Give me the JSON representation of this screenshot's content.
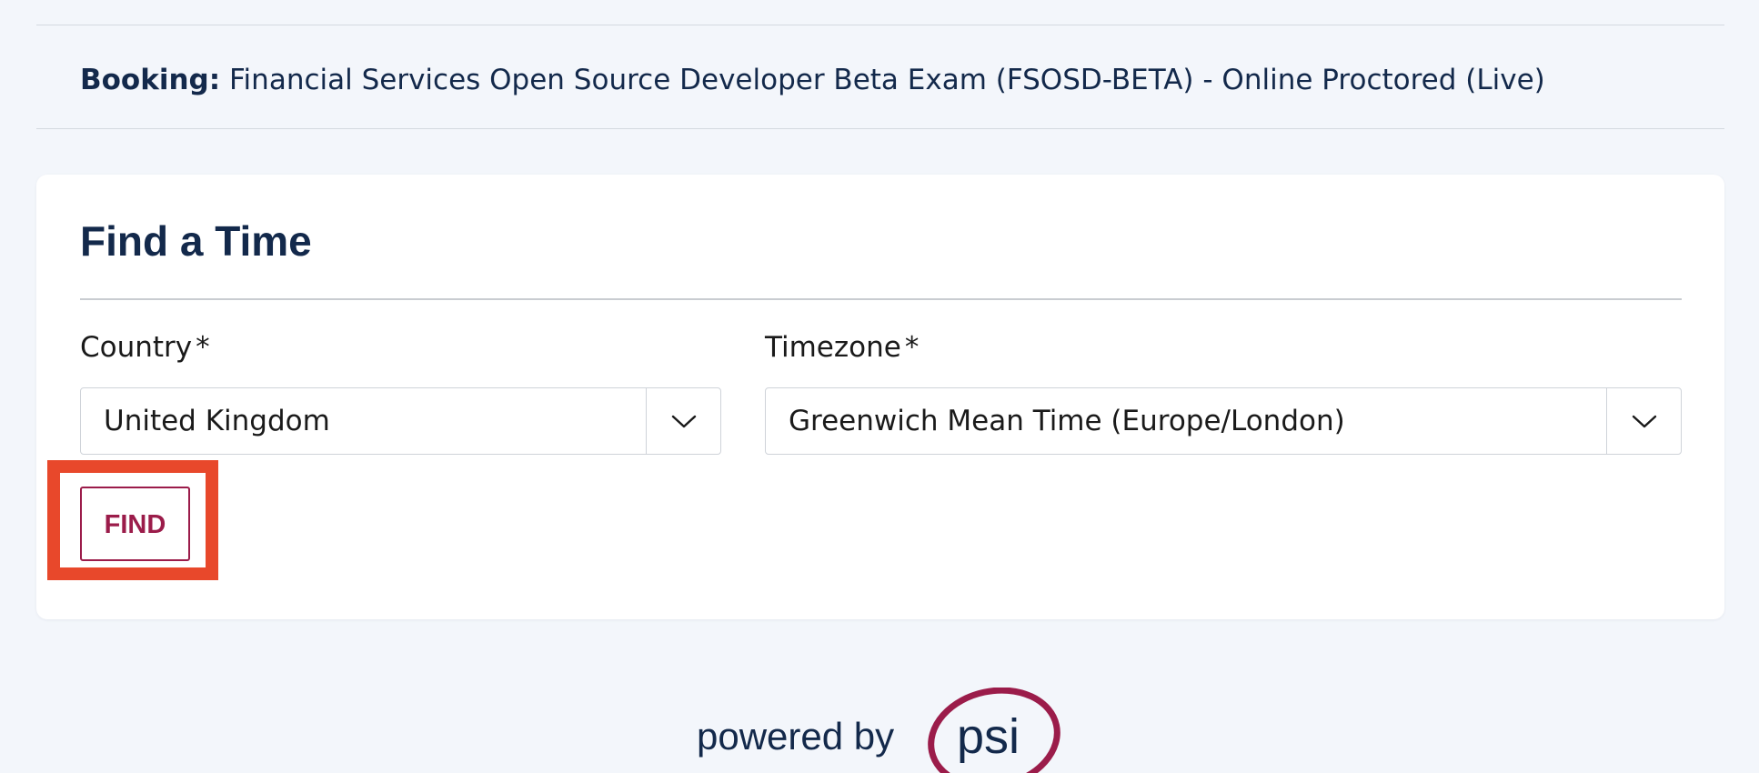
{
  "booking": {
    "label": "Booking:",
    "exam": "Financial Services Open Source Developer Beta Exam (FSOSD-BETA) - Online Proctored (Live)"
  },
  "find_time": {
    "title": "Find a Time",
    "country": {
      "label": "Country",
      "required_mark": "*",
      "value": "United Kingdom",
      "toggle_icon": "chevron-down-icon"
    },
    "timezone": {
      "label": "Timezone",
      "required_mark": "*",
      "value": "Greenwich Mean Time (Europe/London)",
      "toggle_icon": "chevron-down-icon"
    },
    "find_button": "FIND"
  },
  "footer": {
    "powered_by": "powered by",
    "brand": "psi"
  },
  "colors": {
    "page_background": "#f3f6fb",
    "text_navy": "#13294b",
    "brand_maroon": "#9b1c4a",
    "highlight_red": "#e8482b"
  }
}
